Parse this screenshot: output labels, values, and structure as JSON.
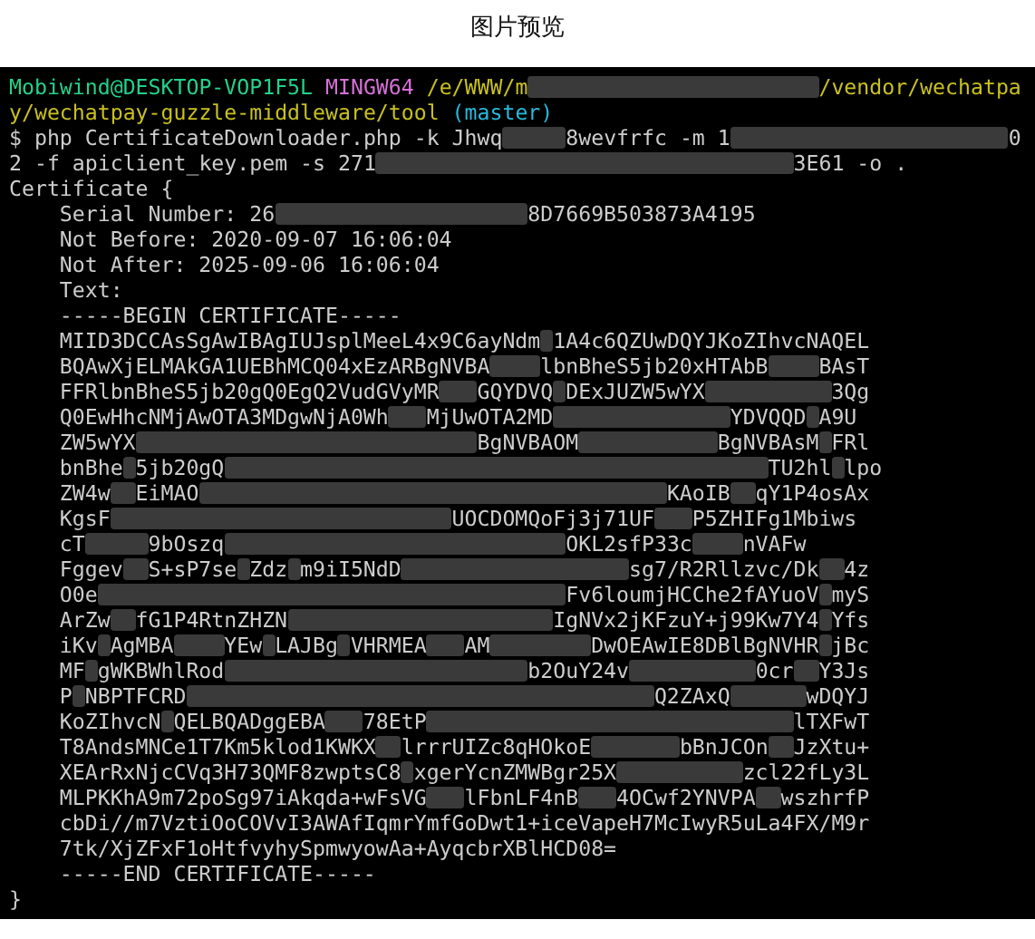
{
  "window": {
    "title": "图片预览"
  },
  "terminal": {
    "lines": [
      {
        "segments": [
          {
            "kind": "user",
            "text": "Mobiwind@DESKTOP-VOP1F5L"
          },
          {
            "kind": "shell",
            "text": "MINGW64"
          },
          {
            "kind": "path",
            "text": "/e/WWW/m"
          },
          {
            "kind": "path",
            "text": "/vendor/wechatpa"
          }
        ]
      },
      {
        "segments": [
          {
            "kind": "path",
            "text": "y/wechatpay-guzzle-middleware/tool"
          },
          {
            "kind": "branch",
            "text": "(master)"
          }
        ]
      },
      {
        "segments": [
          {
            "text": "$ php CertificateDownloader.php -k Jhwq"
          },
          {
            "text": "8wevfrfc -m 1"
          },
          {
            "text": "0"
          }
        ]
      },
      {
        "segments": [
          {
            "text": "2 -f apiclient_key.pem -s 271"
          },
          {
            "text": "3E61 -o ."
          }
        ]
      },
      {
        "segments": [
          {
            "text": "Certificate {"
          }
        ],
        "children": [
          {
            "segments": [
              {
                "text": "Serial Number: 26"
              },
              {
                "text": "8D7669B503873A4195"
              }
            ]
          },
          {
            "segments": [
              {
                "text": "Not Before: 2020-09-07 16:06:04"
              }
            ]
          },
          {
            "segments": [
              {
                "text": "Not After: 2025-09-06 16:06:04"
              }
            ]
          },
          {
            "segments": [
              {
                "text": "Text:"
              }
            ]
          },
          {
            "segments": [
              {
                "text": "-----BEGIN CERTIFICATE-----"
              }
            ]
          },
          {
            "segments": [
              {
                "text": "MIID3DCCAsSgAwIBAgIUJsplMeeL4x9C6ayNdm"
              },
              {
                "text": "1A4c6QZUwDQYJKoZIhvcNAQEL"
              }
            ]
          },
          {
            "segments": [
              {
                "text": "BQAwXjELMAkGA1UEBhMCQ04xEzARBgNVBA"
              },
              {
                "text": "lbnBheS5jb20xHTAbB"
              },
              {
                "text": "BAsT"
              }
            ]
          },
          {
            "segments": [
              {
                "text": "FFRlbnBheS5jb20gQ0EgQ2VudGVyMR"
              },
              {
                "text": "GQYDVQ"
              },
              {
                "text": "DExJUZW5wYX"
              },
              {
                "text": "3Qg"
              }
            ]
          },
          {
            "segments": [
              {
                "text": "Q0EwHhcNMjAwOTA3MDgwNjA0Wh"
              },
              {
                "text": "MjUwOTA2MD"
              },
              {
                "text": "YDVQQD"
              },
              {
                "text": "A9U"
              }
            ]
          },
          {
            "segments": [
              {
                "text": "ZW5wYX"
              },
              {
                "text": "BgNVBAOM"
              },
              {
                "text": "BgNVBAsM"
              },
              {
                "text": "FRl"
              }
            ]
          },
          {
            "segments": [
              {
                "text": "bnBhe"
              },
              {
                "text": "5jb20gQ"
              },
              {
                "text": "TU2hl"
              },
              {
                "text": "lpo"
              }
            ]
          },
          {
            "segments": [
              {
                "text": "ZW4w"
              },
              {
                "text": "EiMAO"
              },
              {
                "text": "KAoIB"
              },
              {
                "text": "qY1P4os"
              },
              {
                "text": "Ax"
              }
            ]
          },
          {
            "segments": [
              {
                "text": "KgsF"
              },
              {
                "text": "UOCDOMQoFj3j71UF"
              },
              {
                "text": "P5ZHIFg1Mbiws"
              }
            ]
          },
          {
            "segments": [
              {
                "text": "cT"
              },
              {
                "text": "9bOszq"
              },
              {
                "text": "OKL2sfP33c"
              },
              {
                "text": "nVAFw"
              }
            ]
          },
          {
            "segments": [
              {
                "text": "Fggev"
              },
              {
                "text": "S+sP7se"
              },
              {
                "text": "Zdz"
              },
              {
                "text": "m9iI5NdD"
              },
              {
                "text": "sg7/R2Rllzvc/Dk"
              },
              {
                "text": "4z"
              }
            ]
          },
          {
            "segments": [
              {
                "text": "O0e"
              },
              {
                "text": "Fv6loumjHCChe2fAYuoV"
              },
              {
                "text": "myS"
              }
            ]
          },
          {
            "segments": [
              {
                "text": "ArZw"
              },
              {
                "text": "fG1P4RtnZHZN"
              },
              {
                "text": "IgNVx2jKFzuY+j99Kw7Y4"
              },
              {
                "text": "Yfs"
              }
            ]
          },
          {
            "segments": [
              {
                "text": "iKv"
              },
              {
                "text": "AgMBA"
              },
              {
                "text": "YEw"
              },
              {
                "text": "LAJBg"
              },
              {
                "text": "VHRMEA"
              },
              {
                "text": "AM"
              },
              {
                "text": "DwOEAwIE8DBlBgNVHR"
              },
              {
                "text": "jBc"
              }
            ]
          },
          {
            "segments": [
              {
                "text": "MF"
              },
              {
                "text": "gWKBWhlRod"
              },
              {
                "text": "b2OuY24v"
              },
              {
                "text": "0cr"
              },
              {
                "text": "Y3Js"
              }
            ]
          },
          {
            "segments": [
              {
                "text": "P"
              },
              {
                "text": "NBPTFCRD"
              },
              {
                "text": "Q2ZAxQ"
              },
              {
                "text": "wDQYJ"
              }
            ]
          },
          {
            "segments": [
              {
                "text": "KoZIhvcN"
              },
              {
                "text": "QELBQADggEBA"
              },
              {
                "text": "78EtP"
              },
              {
                "text": "lTXFwT"
              }
            ]
          },
          {
            "segments": [
              {
                "text": "T8AndsMNCe1T7Km5klod1KWKX"
              },
              {
                "text": "lrrrUIZc8qHOkoE"
              },
              {
                "text": "bBnJCOn"
              },
              {
                "text": "JzXtu+"
              }
            ]
          },
          {
            "segments": [
              {
                "text": "XEArRxNjcCVq3H73QMF8zwptsC8"
              },
              {
                "text": "xgerYcnZMWBgr25X"
              },
              {
                "text": "zcl22fLy3L"
              }
            ]
          },
          {
            "segments": [
              {
                "text": "MLPKKhA9m72poSg97iAkqda+wFsVG"
              },
              {
                "text": "lFbnLF4nB"
              },
              {
                "text": "4OCwf2YNVPA"
              },
              {
                "text": "wszhrfP"
              }
            ]
          },
          {
            "segments": [
              {
                "text": "cbDi//m7VztiOoCOVvI3AWAfIqmrYmfGoDwt1+iceVapeH7McIwyR5uLa4FX/M9r"
              }
            ]
          },
          {
            "segments": [
              {
                "text": "7tk/XjZFxF1oHtfvyhySpmwyowAa+AyqcbrXBlHCD08="
              }
            ]
          },
          {
            "segments": [
              {
                "text": "-----END CERTIFICATE-----"
              }
            ]
          }
        ]
      },
      {
        "segments": [
          {
            "text": "}"
          }
        ]
      }
    ]
  }
}
